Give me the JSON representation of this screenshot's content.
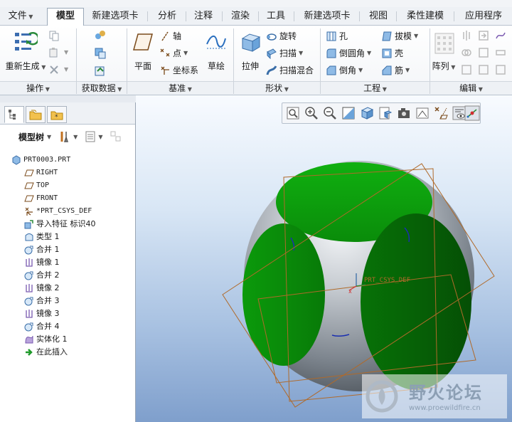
{
  "tabs": [
    "文件",
    "模型",
    "新建选项卡",
    "分析",
    "注释",
    "渲染",
    "工具",
    "新建选项卡",
    "视图",
    "柔性建模",
    "应用程序"
  ],
  "active_tab": "模型",
  "ribbon": {
    "regenerate": "重新生成",
    "plane": "平面",
    "axis": "轴",
    "point": "点",
    "csys": "坐标系",
    "sketch": "草绘",
    "extrude": "拉伸",
    "revolve": "旋转",
    "sweep": "扫描",
    "swept_blend": "扫描混合",
    "hole": "孔",
    "round": "倒圆角",
    "chamfer": "倒角",
    "draft": "拔模",
    "shell": "壳",
    "rib": "筋",
    "pattern": "阵列",
    "groups": [
      "操作",
      "获取数据",
      "基准",
      "形状",
      "工程",
      "编辑"
    ]
  },
  "model_tree": {
    "title": "模型树",
    "items": [
      {
        "label": "PRT0003.PRT",
        "icon": "part-icon"
      },
      {
        "label": "RIGHT",
        "icon": "datum-plane-icon"
      },
      {
        "label": "TOP",
        "icon": "datum-plane-icon"
      },
      {
        "label": "FRONT",
        "icon": "datum-plane-icon"
      },
      {
        "label": "*PRT_CSYS_DEF",
        "icon": "csys-icon"
      },
      {
        "label": "导入特征 标识40",
        "icon": "import-feature-icon"
      },
      {
        "label": "类型 1",
        "icon": "surface-icon"
      },
      {
        "label": "合并 1",
        "icon": "merge-icon"
      },
      {
        "label": "镜像 1",
        "icon": "mirror-icon"
      },
      {
        "label": "合并 2",
        "icon": "merge-icon"
      },
      {
        "label": "镜像 2",
        "icon": "mirror-icon"
      },
      {
        "label": "合并 3",
        "icon": "merge-icon"
      },
      {
        "label": "镜像 3",
        "icon": "mirror-icon"
      },
      {
        "label": "合并 4",
        "icon": "merge-icon"
      },
      {
        "label": "实体化 1",
        "icon": "solidify-icon"
      },
      {
        "label": "在此插入",
        "icon": "insert-here-arrow-icon"
      }
    ]
  },
  "viewport": {
    "csys_label": "PRT_CSYS_DEF",
    "watermark_title": "野火论坛",
    "watermark_url": "www.proewildfire.cn"
  },
  "colors": {
    "face_green": "#0a9a0a",
    "datum_plane": "#b06a2a",
    "accent": "#2a6fbf"
  }
}
